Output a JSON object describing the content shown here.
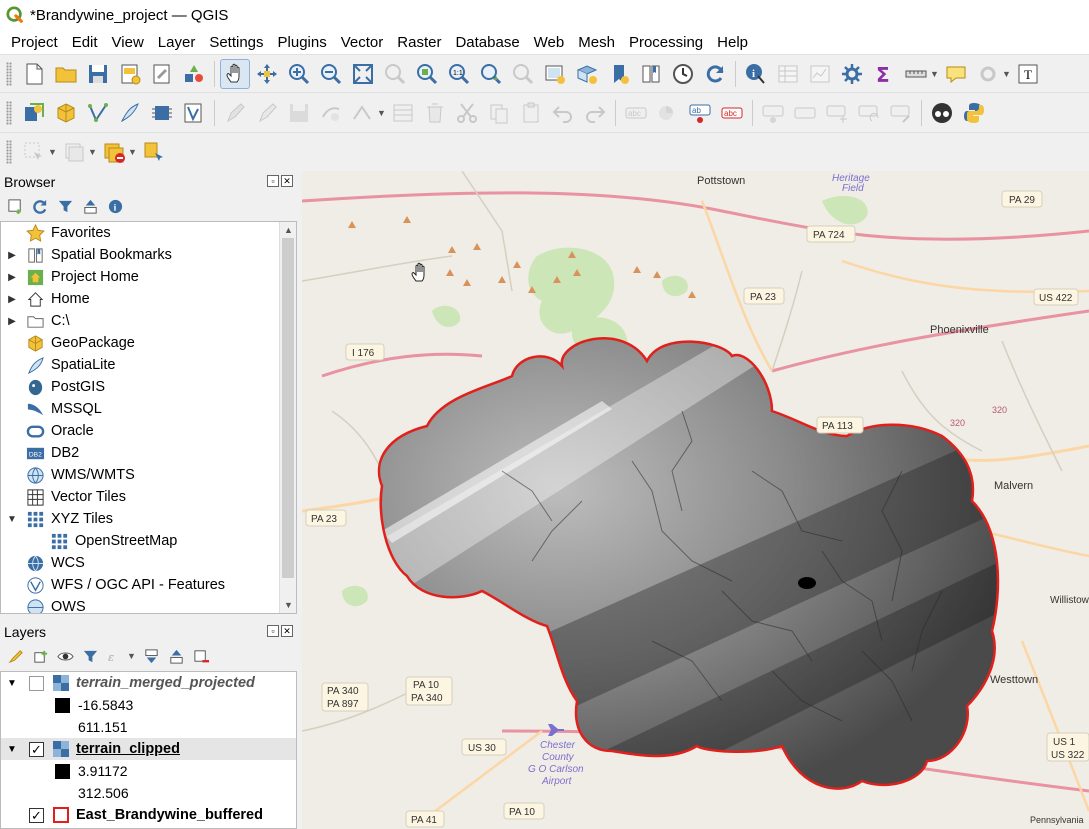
{
  "window": {
    "title": "*Brandywine_project — QGIS"
  },
  "menus": [
    "Project",
    "Edit",
    "View",
    "Layer",
    "Settings",
    "Plugins",
    "Vector",
    "Raster",
    "Database",
    "Web",
    "Mesh",
    "Processing",
    "Help"
  ],
  "browser": {
    "title": "Browser",
    "items": [
      {
        "label": "Favorites",
        "icon": "star-icon",
        "arrow": ""
      },
      {
        "label": "Spatial Bookmarks",
        "icon": "bookmark-icon",
        "arrow": "▶"
      },
      {
        "label": "Project Home",
        "icon": "project-home-icon",
        "arrow": "▶"
      },
      {
        "label": "Home",
        "icon": "home-icon",
        "arrow": "▶"
      },
      {
        "label": "C:\\",
        "icon": "folder-icon",
        "arrow": "▶"
      },
      {
        "label": "GeoPackage",
        "icon": "geopackage-icon",
        "arrow": ""
      },
      {
        "label": "SpatiaLite",
        "icon": "spatialite-icon",
        "arrow": ""
      },
      {
        "label": "PostGIS",
        "icon": "postgis-icon",
        "arrow": ""
      },
      {
        "label": "MSSQL",
        "icon": "mssql-icon",
        "arrow": ""
      },
      {
        "label": "Oracle",
        "icon": "oracle-icon",
        "arrow": ""
      },
      {
        "label": "DB2",
        "icon": "db2-icon",
        "arrow": ""
      },
      {
        "label": "WMS/WMTS",
        "icon": "wms-icon",
        "arrow": ""
      },
      {
        "label": "Vector Tiles",
        "icon": "vector-tiles-icon",
        "arrow": ""
      },
      {
        "label": "XYZ Tiles",
        "icon": "xyz-tiles-icon",
        "arrow": "▼"
      },
      {
        "label": "OpenStreetMap",
        "icon": "xyz-tiles-icon",
        "arrow": "",
        "child": true
      },
      {
        "label": "WCS",
        "icon": "wcs-icon",
        "arrow": ""
      },
      {
        "label": "WFS / OGC API - Features",
        "icon": "wfs-icon",
        "arrow": ""
      },
      {
        "label": "OWS",
        "icon": "ows-icon",
        "arrow": ""
      }
    ]
  },
  "layers": {
    "title": "Layers",
    "items": [
      {
        "name": "terrain_merged_projected",
        "checked": false,
        "style": "italic",
        "min": "-16.5843",
        "max": "611.151"
      },
      {
        "name": "terrain_clipped",
        "checked": true,
        "style": "underline",
        "min": "3.91172",
        "max": "312.506"
      },
      {
        "name": "East_Brandywine_buffered",
        "checked": true,
        "style": "bold"
      }
    ]
  },
  "map": {
    "labels": {
      "pottstown": "Pottstown",
      "heritage": "Heritage",
      "field": "Field",
      "pa29": "PA 29",
      "pa724": "PA 724",
      "pa23a": "PA 23",
      "us422": "US 422",
      "phoenixville": "Phoenixville",
      "i176": "I 176",
      "pa113": "PA 113",
      "r320a": "320",
      "r320b": "320",
      "malvern": "Malvern",
      "pa23b": "PA 23",
      "willistown": "Willistown",
      "pa340": "PA 340",
      "pa897": "PA 897",
      "pa10a": "PA 10",
      "pa340b": "PA 340",
      "us30": "US 30",
      "chester": "Chester",
      "county": "County",
      "gocarlson": "G O Carlson",
      "airport": "Airport",
      "westtown": "Westtown",
      "us1": "US 1",
      "us322": "US 322",
      "pa41": "PA 41",
      "pa10b": "PA 10",
      "pennsylvania": "Pennsylvania"
    },
    "colors": {
      "buffer_outline": "#e0201c",
      "highway": "#e892a2",
      "primary": "#fcd6a4",
      "park": "#c8e6b0"
    }
  }
}
